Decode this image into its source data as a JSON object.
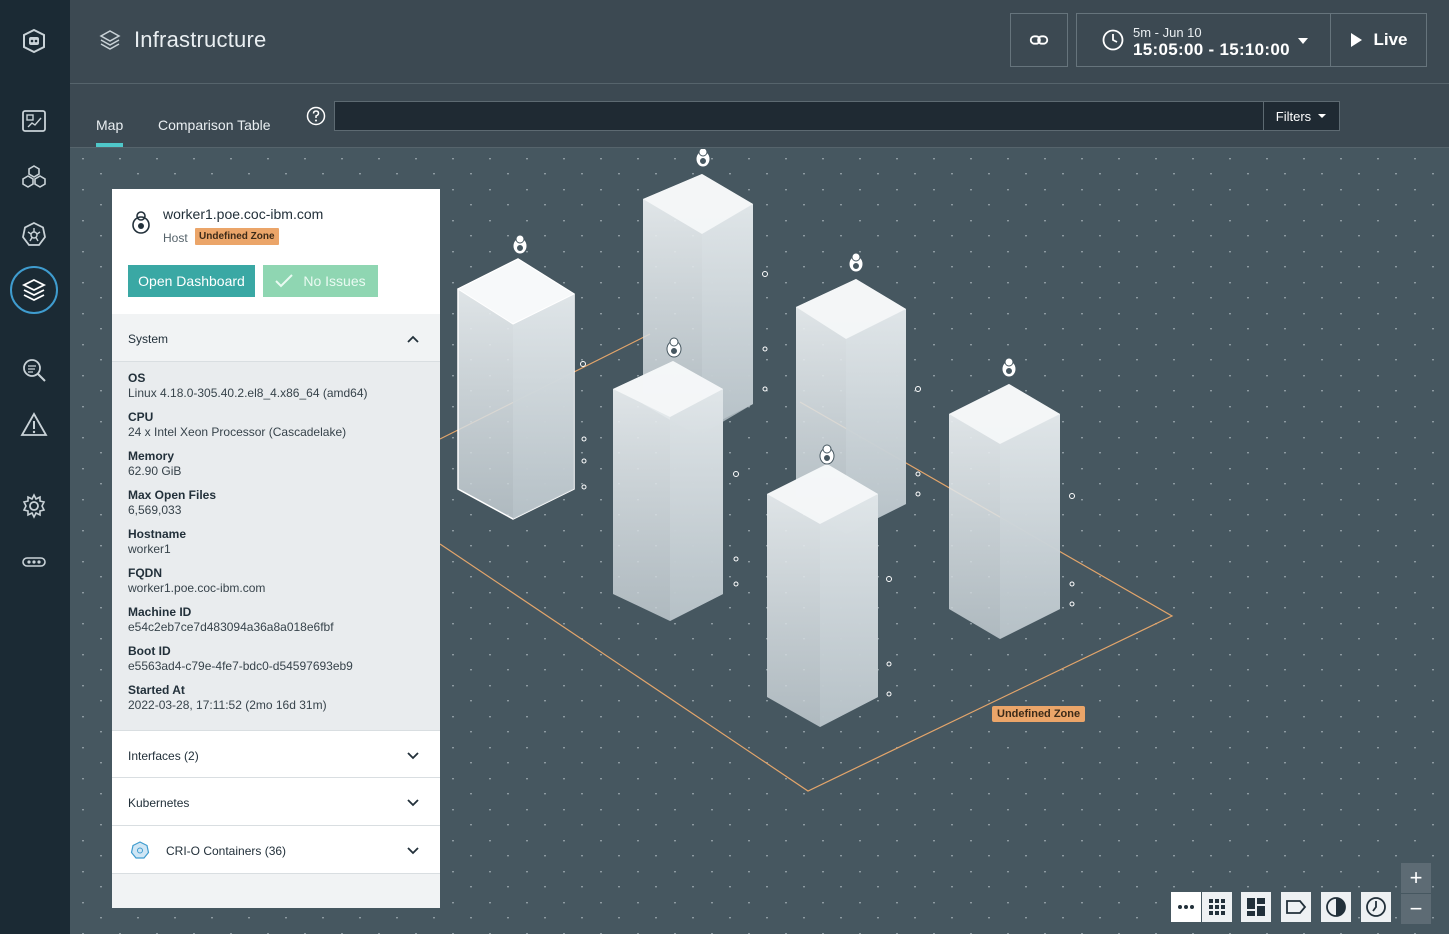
{
  "app": {
    "title": "Infrastructure"
  },
  "header": {
    "time_range": "5m - Jun 10",
    "time_value": "15:05:00 - 15:10:00",
    "live_label": "Live"
  },
  "tabs": [
    {
      "label": "Map",
      "active": true
    },
    {
      "label": "Comparison Table",
      "active": false
    }
  ],
  "search": {
    "placeholder": "",
    "value": ""
  },
  "filters_label": "Filters",
  "map": {
    "zone_label": "Undefined Zone"
  },
  "panel": {
    "host_name": "worker1.poe.coc-ibm.com",
    "host_type": "Host",
    "zone_badge": "Undefined Zone",
    "open_dashboard": "Open Dashboard",
    "no_issues": "No Issues",
    "sections": {
      "system": "System",
      "interfaces": "Interfaces (2)",
      "kubernetes": "Kubernetes",
      "containers": "CRI-O Containers (36)"
    },
    "properties": [
      {
        "key": "OS",
        "value": "Linux 4.18.0-305.40.2.el8_4.x86_64 (amd64)"
      },
      {
        "key": "CPU",
        "value": "24 x Intel Xeon Processor (Cascadelake)"
      },
      {
        "key": "Memory",
        "value": "62.90 GiB"
      },
      {
        "key": "Max Open Files",
        "value": "6,569,033"
      },
      {
        "key": "Hostname",
        "value": "worker1"
      },
      {
        "key": "FQDN",
        "value": "worker1.poe.coc-ibm.com"
      },
      {
        "key": "Machine ID",
        "value": "e54c2eb7ce7d483094a36a8a018e6fbf"
      },
      {
        "key": "Boot ID",
        "value": "e5563ad4-c79e-4fe7-bdc0-d54597693eb9"
      },
      {
        "key": "Started At",
        "value": "2022-03-28, 17:11:52 (2mo 16d 31m)"
      }
    ]
  },
  "colors": {
    "accent": "#4fc7c9",
    "zone": "#eba569",
    "sidebar": "#1b2a34",
    "map": "#465760"
  },
  "icons": [
    "robot-logo-icon",
    "dashboard-icon",
    "applications-icon",
    "kubernetes-icon",
    "infrastructure-icon",
    "analyze-icon",
    "alert-icon",
    "settings-icon",
    "more-icon"
  ]
}
